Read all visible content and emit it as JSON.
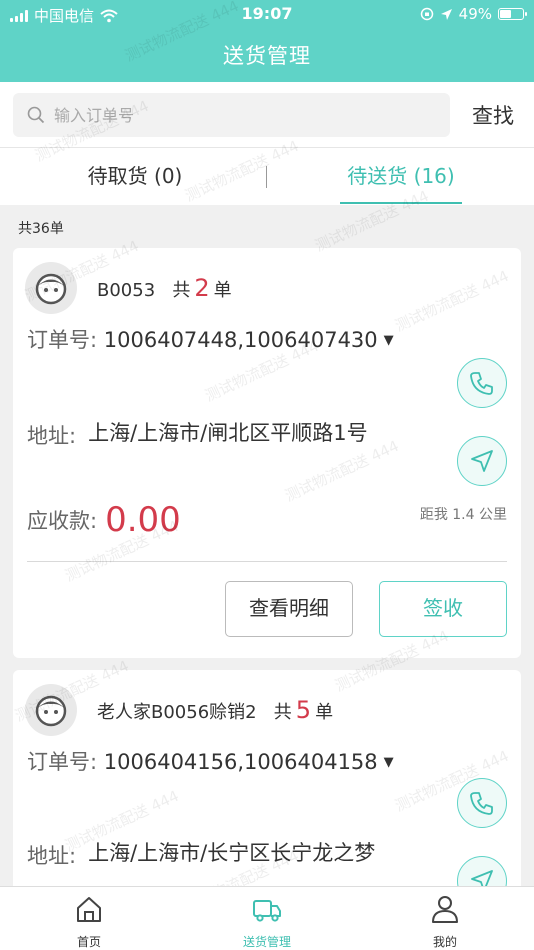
{
  "status_bar": {
    "carrier": "中国电信",
    "time": "19:07",
    "battery": "49%"
  },
  "header": {
    "title": "送货管理"
  },
  "search": {
    "placeholder": "输入订单号",
    "button": "查找"
  },
  "tabs": [
    {
      "label": "待取货 (0)",
      "active": false
    },
    {
      "label": "待送货 (16)",
      "active": true
    }
  ],
  "summary": {
    "total": "共36单"
  },
  "orders": [
    {
      "customer": "B0053",
      "count_prefix": "共",
      "count": "2",
      "count_suffix": "单",
      "order_label": "订单号:",
      "order_nos": "1006407448,1006407430",
      "address_label": "地址:",
      "address": "上海/上海市/闸北区平顺路1号",
      "amount_label": "应收款:",
      "amount": "0.00",
      "distance": "距我 1.4 公里",
      "detail_button": "查看明细",
      "sign_button": "签收"
    },
    {
      "customer": "老人家B0056赊销2",
      "count_prefix": "共",
      "count": "5",
      "count_suffix": "单",
      "order_label": "订单号:",
      "order_nos": "1006404156,1006404158",
      "address_label": "地址:",
      "address": "上海/上海市/长宁区长宁龙之梦"
    }
  ],
  "tabbar": [
    {
      "label": "首页",
      "icon": "home-icon",
      "active": false
    },
    {
      "label": "送货管理",
      "icon": "truck-icon",
      "active": true
    },
    {
      "label": "我的",
      "icon": "user-icon",
      "active": false
    }
  ],
  "watermark": "测试物流配送 444",
  "colors": {
    "accent": "#5fd3c7",
    "accent_text": "#3fbfb1",
    "highlight": "#d33b4b"
  }
}
